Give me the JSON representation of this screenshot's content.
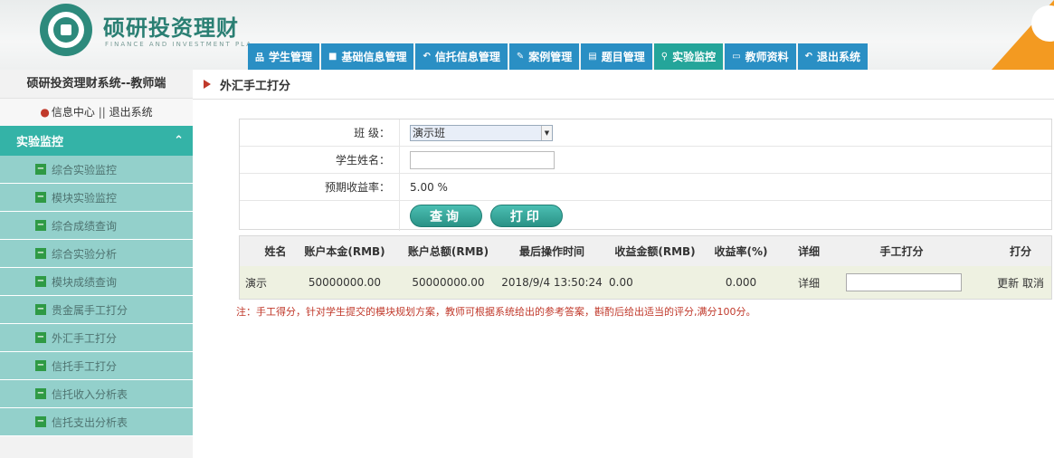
{
  "header": {
    "title": "硕研投资理财",
    "subtitle": "FINANCE AND INVESTMENT PLANNING"
  },
  "nav": [
    {
      "label": "学生管理",
      "icon": "sitemap-icon",
      "glyph": "品",
      "active": false
    },
    {
      "label": "基础信息管理",
      "icon": "book-icon",
      "glyph": "■",
      "active": false
    },
    {
      "label": "信托信息管理",
      "icon": "reply-icon",
      "glyph": "↶",
      "active": false
    },
    {
      "label": "案例管理",
      "icon": "pencil-icon",
      "glyph": "✎",
      "active": false
    },
    {
      "label": "题目管理",
      "icon": "list-icon",
      "glyph": "▤",
      "active": false
    },
    {
      "label": "实验监控",
      "icon": "map-marker-icon",
      "glyph": "⚲",
      "active": true
    },
    {
      "label": "教师资料",
      "icon": "monitor-icon",
      "glyph": "▭",
      "active": false
    },
    {
      "label": "退出系统",
      "icon": "logout-icon",
      "glyph": "↶",
      "active": false
    }
  ],
  "sidebar": {
    "title": "硕研投资理财系统--教师端",
    "info_center": "信息中心",
    "separator": " || ",
    "logout": "退出系统",
    "section": "实验监控",
    "items": [
      {
        "label": "综合实验监控"
      },
      {
        "label": "模块实验监控"
      },
      {
        "label": "综合成绩查询"
      },
      {
        "label": "综合实验分析"
      },
      {
        "label": "模块成绩查询"
      },
      {
        "label": "贵金属手工打分"
      },
      {
        "label": "外汇手工打分"
      },
      {
        "label": "信托手工打分"
      },
      {
        "label": "信托收入分析表"
      },
      {
        "label": "信托支出分析表"
      }
    ]
  },
  "page": {
    "title": "外汇手工打分"
  },
  "form": {
    "class_label": "班 级：",
    "class_value": "演示班",
    "student_label": "学生姓名：",
    "student_value": "",
    "rate_label": "预期收益率：",
    "rate_value": "5.00 %",
    "query_btn": "查询",
    "print_btn": "打印"
  },
  "table": {
    "headers": [
      "姓名",
      "账户本金(RMB)",
      "账户总额(RMB)",
      "最后操作时间",
      "收益金额(RMB)",
      "收益率(%)",
      "详细",
      "手工打分",
      "打分"
    ],
    "rows": [
      {
        "name": "演示",
        "principal": "50000000.00",
        "total": "50000000.00",
        "last_time": "2018/9/4 13:50:24",
        "profit": "0.00",
        "rate": "0.000",
        "detail": "详细",
        "score": "",
        "update": "更新",
        "cancel": "取消"
      }
    ]
  },
  "note": "注：手工得分，针对学生提交的模块规划方案，教师可根据系统给出的参考答案，斟酌后给出适当的评分,满分100分。"
}
